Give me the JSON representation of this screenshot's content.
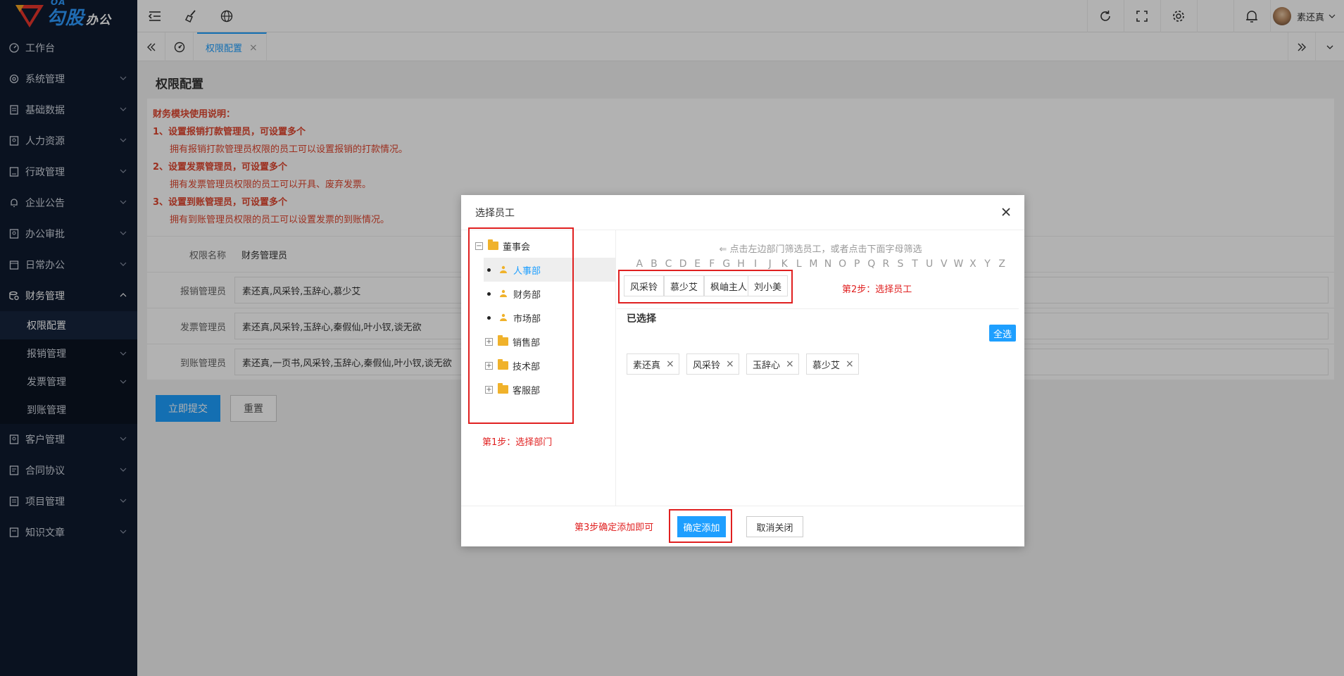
{
  "brand": {
    "oa": "OA",
    "name": "勾股",
    "sub": "办公"
  },
  "sidebar": {
    "items": [
      {
        "label": "工作台",
        "icon": "dashboard-icon"
      },
      {
        "label": "系统管理",
        "icon": "settings-icon"
      },
      {
        "label": "基础数据",
        "icon": "database-icon"
      },
      {
        "label": "人力资源",
        "icon": "person-icon"
      },
      {
        "label": "行政管理",
        "icon": "admin-icon"
      },
      {
        "label": "企业公告",
        "icon": "bell-icon"
      },
      {
        "label": "办公审批",
        "icon": "approval-icon"
      },
      {
        "label": "日常办公",
        "icon": "calendar-icon"
      },
      {
        "label": "财务管理",
        "icon": "finance-icon"
      }
    ],
    "finance_sub": [
      {
        "label": "权限配置",
        "active": true
      },
      {
        "label": "报销管理"
      },
      {
        "label": "发票管理"
      },
      {
        "label": "到账管理"
      }
    ],
    "items_after": [
      {
        "label": "客户管理",
        "icon": "customer-icon"
      },
      {
        "label": "合同协议",
        "icon": "contract-icon"
      },
      {
        "label": "项目管理",
        "icon": "project-icon"
      },
      {
        "label": "知识文章",
        "icon": "article-icon"
      }
    ]
  },
  "topbar": {
    "user_name": "素还真"
  },
  "tabs": {
    "active_label": "权限配置"
  },
  "page": {
    "title": "权限配置",
    "notice": {
      "title": "财务模块使用说明：",
      "lines": [
        {
          "head": "1、设置报销打款管理员，可设置多个",
          "desc": "拥有报销打款管理员权限的员工可以设置报销的打款情况。"
        },
        {
          "head": "2、设置发票管理员，可设置多个",
          "desc": "拥有发票管理员权限的员工可以开具、废弃发票。"
        },
        {
          "head": "3、设置到账管理员，可设置多个",
          "desc": "拥有到账管理员权限的员工可以设置发票的到账情况。"
        }
      ]
    },
    "form": {
      "name_label": "权限名称",
      "name_value": "财务管理员",
      "rows": [
        {
          "label": "报销管理员",
          "value": "素还真,风采铃,玉辞心,慕少艾"
        },
        {
          "label": "发票管理员",
          "value": "素还真,风采铃,玉辞心,秦假仙,叶小钗,谈无欲"
        },
        {
          "label": "到账管理员",
          "value": "素还真,一页书,风采铃,玉辞心,秦假仙,叶小钗,谈无欲"
        }
      ],
      "submit": "立即提交",
      "reset": "重置"
    }
  },
  "modal": {
    "title": "选择员工",
    "tree": [
      {
        "label": "董事会",
        "type": "root"
      },
      {
        "label": "人事部",
        "type": "leaf",
        "selected": true
      },
      {
        "label": "财务部",
        "type": "leaf"
      },
      {
        "label": "市场部",
        "type": "leaf"
      },
      {
        "label": "销售部",
        "type": "folder"
      },
      {
        "label": "技术部",
        "type": "folder"
      },
      {
        "label": "客服部",
        "type": "folder"
      }
    ],
    "step1": "第1步：选择部门",
    "hint": "⇐ 点击左边部门筛选员工，或者点击下面字母筛选",
    "letters": [
      "A",
      "B",
      "C",
      "D",
      "E",
      "F",
      "G",
      "H",
      "I",
      "J",
      "K",
      "L",
      "M",
      "N",
      "O",
      "P",
      "Q",
      "R",
      "S",
      "T",
      "U",
      "V",
      "W",
      "X",
      "Y",
      "Z"
    ],
    "employees": [
      "风采铃",
      "慕少艾",
      "枫岫主人",
      "刘小美"
    ],
    "step2": "第2步：选择员工",
    "selected_title": "已选择",
    "select_all": "全选",
    "selected": [
      "素还真",
      "风采铃",
      "玉辞心",
      "慕少艾"
    ],
    "step3": "第3步确定添加即可",
    "confirm": "确定添加",
    "cancel": "取消关闭"
  }
}
